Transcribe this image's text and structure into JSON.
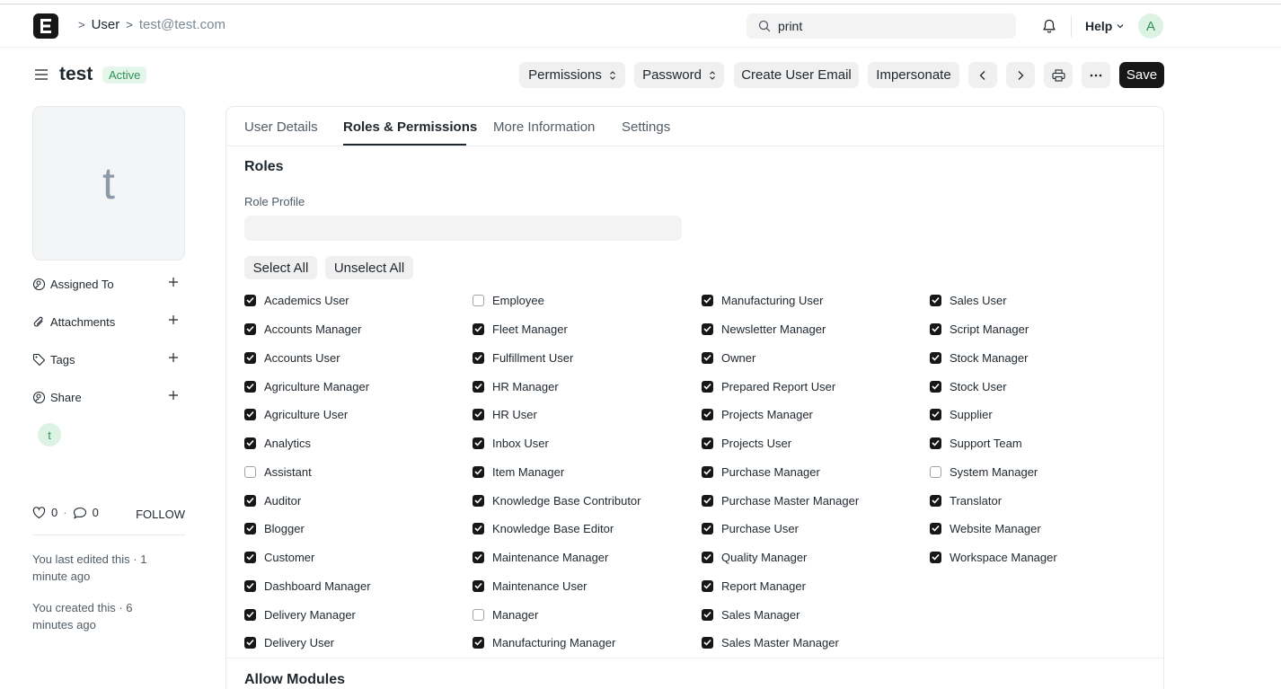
{
  "navbar": {
    "breadcrumbs": [
      ">",
      "User",
      ">",
      "test@test.com"
    ],
    "search_value": "print",
    "help_label": "Help",
    "avatar_initial": "A"
  },
  "doc": {
    "title": "test",
    "status": "Active"
  },
  "toolbar": {
    "permissions": "Permissions",
    "password": "Password",
    "create_email": "Create User Email",
    "impersonate": "Impersonate",
    "save": "Save"
  },
  "sidebar": {
    "avatar_letter": "t",
    "assigned_to": "Assigned To",
    "attachments": "Attachments",
    "tags": "Tags",
    "share": "Share",
    "share_avatar": "t",
    "likes": "0",
    "comments": "0",
    "follow": "FOLLOW",
    "last_edited": "You last edited this · 1 minute ago",
    "created": "You created this · 6 minutes ago"
  },
  "tabs": [
    "User Details",
    "Roles & Permissions",
    "More Information",
    "Settings"
  ],
  "roles_section": {
    "heading": "Roles",
    "role_profile_label": "Role Profile",
    "select_all": "Select All",
    "unselect_all": "Unselect All",
    "next_heading": "Allow Modules"
  },
  "roles": [
    [
      {
        "label": "Academics User",
        "checked": true
      },
      {
        "label": "Accounts Manager",
        "checked": true
      },
      {
        "label": "Accounts User",
        "checked": true
      },
      {
        "label": "Agriculture Manager",
        "checked": true
      },
      {
        "label": "Agriculture User",
        "checked": true
      },
      {
        "label": "Analytics",
        "checked": true
      },
      {
        "label": "Assistant",
        "checked": false
      },
      {
        "label": "Auditor",
        "checked": true
      },
      {
        "label": "Blogger",
        "checked": true
      },
      {
        "label": "Customer",
        "checked": true
      },
      {
        "label": "Dashboard Manager",
        "checked": true
      },
      {
        "label": "Delivery Manager",
        "checked": true
      },
      {
        "label": "Delivery User",
        "checked": true
      }
    ],
    [
      {
        "label": "Employee",
        "checked": false
      },
      {
        "label": "Fleet Manager",
        "checked": true
      },
      {
        "label": "Fulfillment User",
        "checked": true
      },
      {
        "label": "HR Manager",
        "checked": true
      },
      {
        "label": "HR User",
        "checked": true
      },
      {
        "label": "Inbox User",
        "checked": true
      },
      {
        "label": "Item Manager",
        "checked": true
      },
      {
        "label": "Knowledge Base Contributor",
        "checked": true
      },
      {
        "label": "Knowledge Base Editor",
        "checked": true
      },
      {
        "label": "Maintenance Manager",
        "checked": true
      },
      {
        "label": "Maintenance User",
        "checked": true
      },
      {
        "label": "Manager",
        "checked": false
      },
      {
        "label": "Manufacturing Manager",
        "checked": true
      }
    ],
    [
      {
        "label": "Manufacturing User",
        "checked": true
      },
      {
        "label": "Newsletter Manager",
        "checked": true
      },
      {
        "label": "Owner",
        "checked": true
      },
      {
        "label": "Prepared Report User",
        "checked": true
      },
      {
        "label": "Projects Manager",
        "checked": true
      },
      {
        "label": "Projects User",
        "checked": true
      },
      {
        "label": "Purchase Manager",
        "checked": true
      },
      {
        "label": "Purchase Master Manager",
        "checked": true
      },
      {
        "label": "Purchase User",
        "checked": true
      },
      {
        "label": "Quality Manager",
        "checked": true
      },
      {
        "label": "Report Manager",
        "checked": true
      },
      {
        "label": "Sales Manager",
        "checked": true
      },
      {
        "label": "Sales Master Manager",
        "checked": true
      }
    ],
    [
      {
        "label": "Sales User",
        "checked": true
      },
      {
        "label": "Script Manager",
        "checked": true
      },
      {
        "label": "Stock Manager",
        "checked": true
      },
      {
        "label": "Stock User",
        "checked": true
      },
      {
        "label": "Supplier",
        "checked": true
      },
      {
        "label": "Support Team",
        "checked": true
      },
      {
        "label": "System Manager",
        "checked": false
      },
      {
        "label": "Translator",
        "checked": true
      },
      {
        "label": "Website Manager",
        "checked": true
      },
      {
        "label": "Workspace Manager",
        "checked": true
      }
    ]
  ]
}
